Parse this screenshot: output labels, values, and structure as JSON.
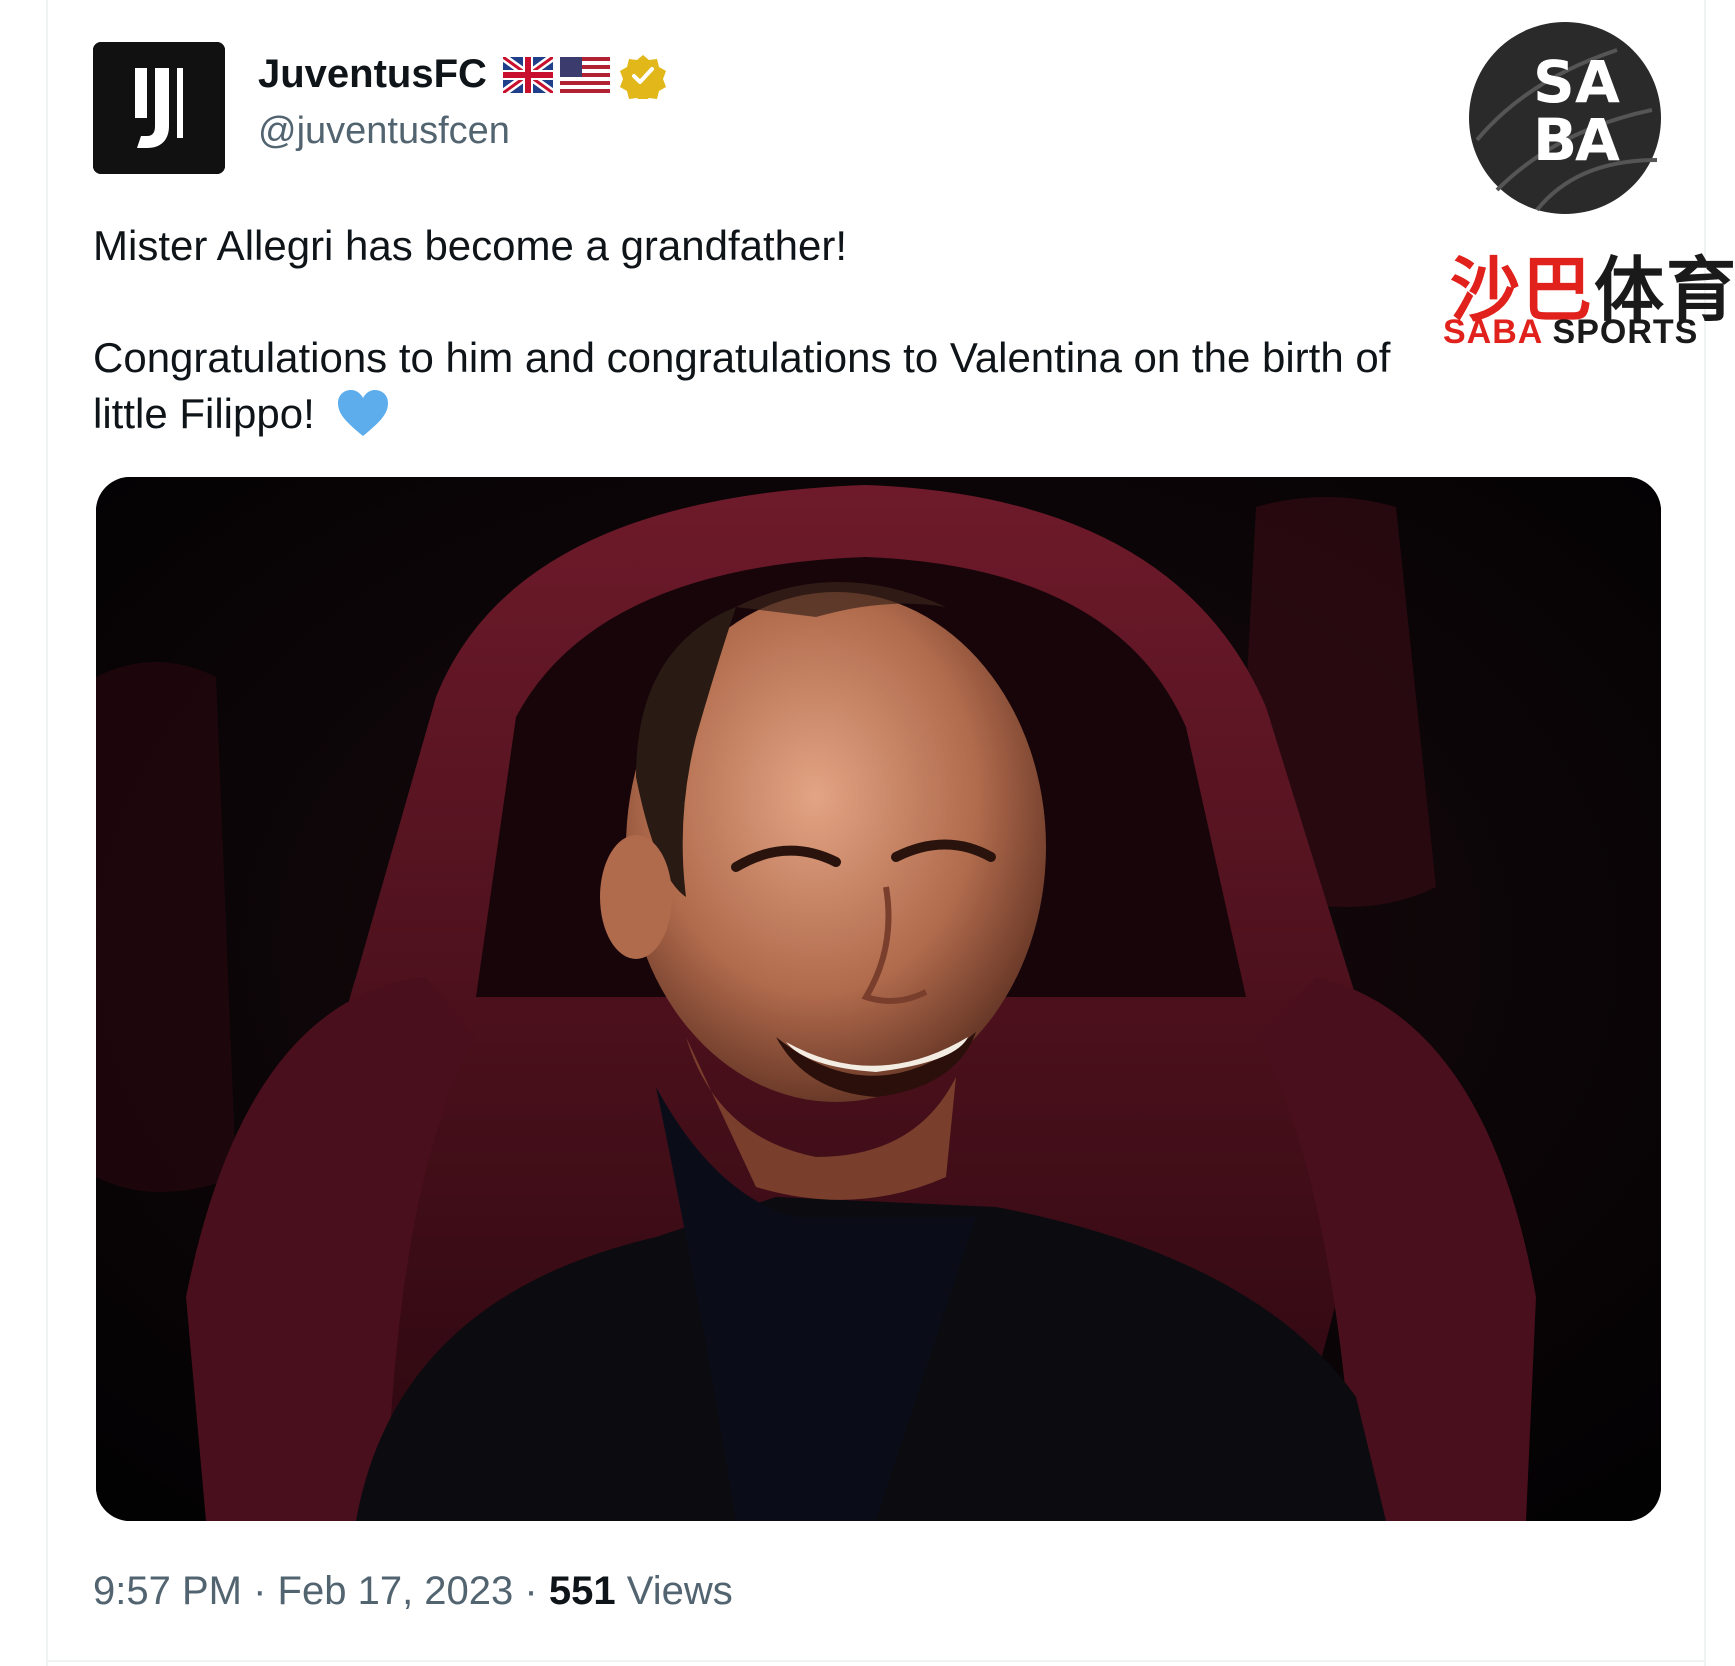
{
  "tweet": {
    "author": {
      "display_name": "JuventusFC",
      "handle": "@juventusfcen",
      "badges": [
        "uk-flag-icon",
        "us-flag-icon",
        "verified-gold-icon"
      ],
      "avatar_icon": "juventus-j-logo"
    },
    "text": {
      "line1": "Mister Allegri has become a grandfather!",
      "line2": "Congratulations to him and congratulations to Valentina on the birth of",
      "line3": "little Filippo!",
      "emoji": "blue-heart-icon"
    },
    "media": {
      "type": "photo",
      "subject": "smiling-man-in-stadium-seat"
    },
    "footer": {
      "time": "9:57 PM",
      "separator": "·",
      "date": "Feb 17, 2023",
      "views_count": "551",
      "views_label": "Views"
    }
  },
  "watermark": {
    "circle_text": "SABA",
    "chinese_text_red": "沙巴",
    "chinese_text_dark": "体育",
    "english_red": "SABA",
    "english_dark": "SPORTS"
  },
  "colors": {
    "text_primary": "#0f1419",
    "text_secondary": "#536471",
    "verified_gold": "#e2b719",
    "heart_blue": "#5dadec",
    "watermark_red": "#e1211b"
  }
}
